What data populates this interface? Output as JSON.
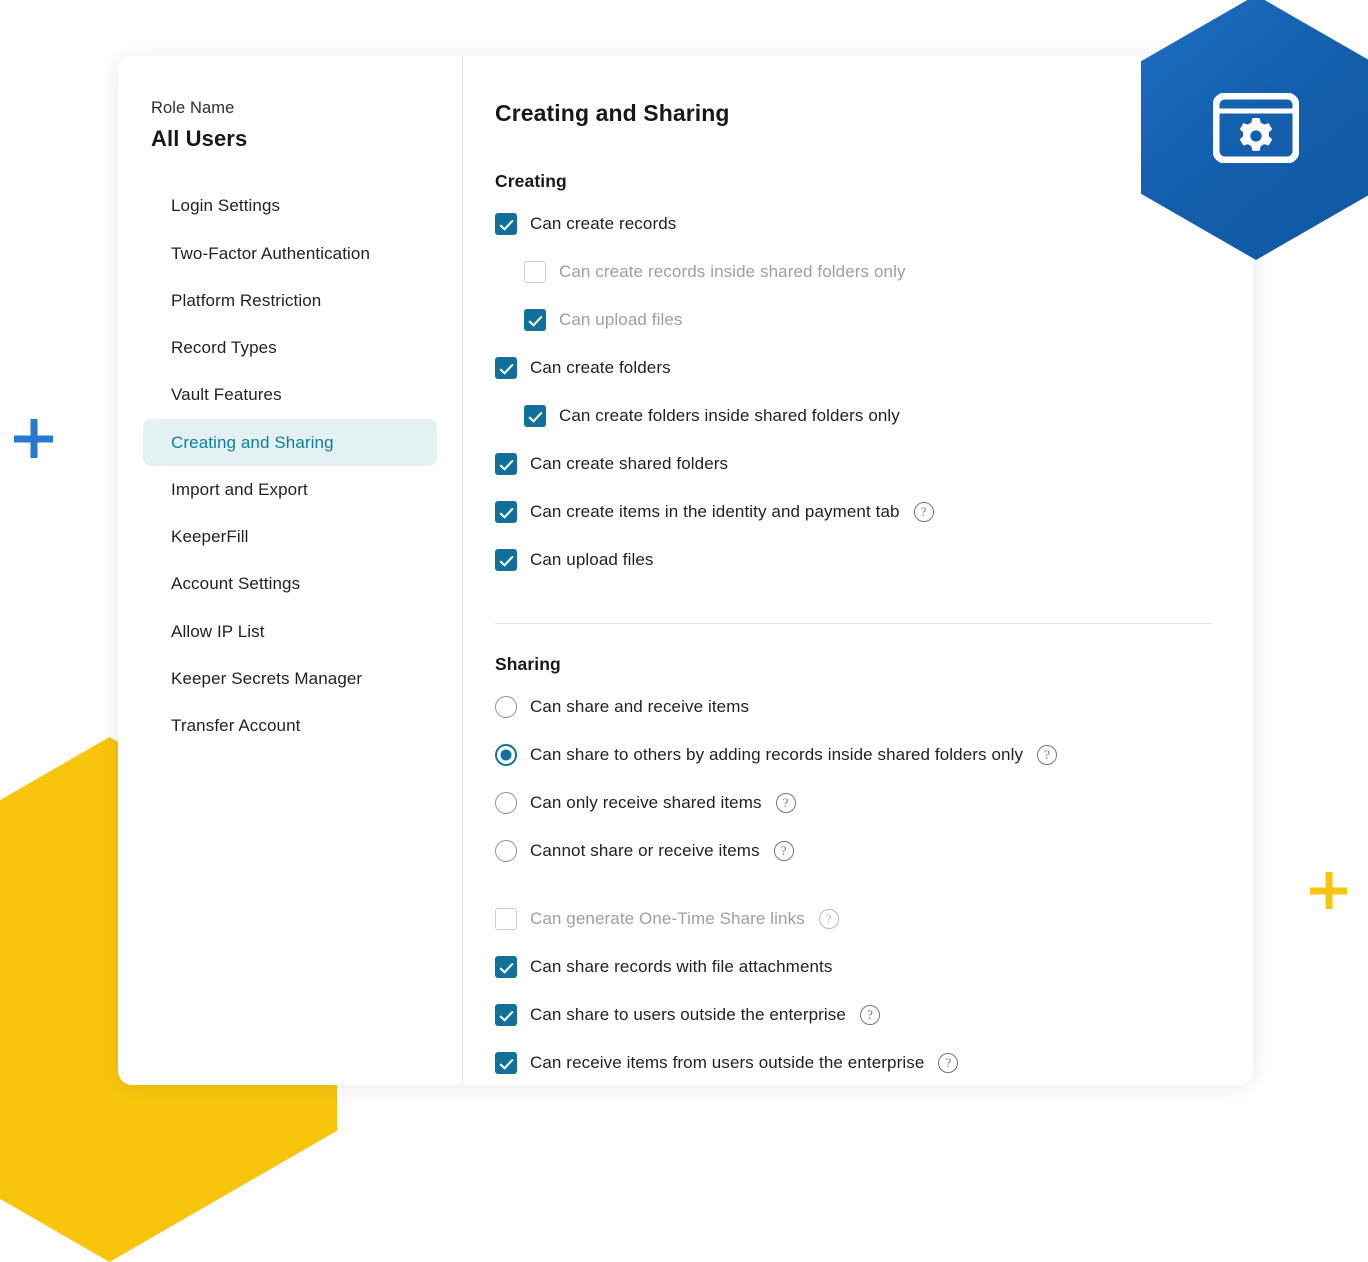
{
  "decor": {
    "hexagon_blue_icon": "browser-window-gear-icon",
    "hexagon_blue_color": "#1560ae",
    "hexagon_yellow_color": "#f8c50c",
    "plus_blue_color": "#2878d0",
    "plus_yellow_color": "#f8c50c"
  },
  "sidebar": {
    "role_label": "Role Name",
    "role_value": "All Users",
    "items": [
      {
        "label": "Login Settings",
        "active": false
      },
      {
        "label": "Two-Factor Authentication",
        "active": false
      },
      {
        "label": "Platform Restriction",
        "active": false
      },
      {
        "label": "Record Types",
        "active": false
      },
      {
        "label": "Vault Features",
        "active": false
      },
      {
        "label": "Creating and Sharing",
        "active": true
      },
      {
        "label": "Import and Export",
        "active": false
      },
      {
        "label": "KeeperFill",
        "active": false
      },
      {
        "label": "Account Settings",
        "active": false
      },
      {
        "label": "Allow IP List",
        "active": false
      },
      {
        "label": "Keeper Secrets Manager",
        "active": false
      },
      {
        "label": "Transfer Account",
        "active": false
      }
    ],
    "active_bg": "#e4f1f3",
    "active_color": "#0d7fa2"
  },
  "main": {
    "title": "Creating and Sharing",
    "accent_color": "#11719b",
    "creating": {
      "heading": "Creating",
      "options": [
        {
          "label": "Can create records",
          "control": "checkbox",
          "checked": true,
          "indent": false,
          "dim": false,
          "help": false
        },
        {
          "label": "Can create records inside shared folders only",
          "control": "checkbox",
          "checked": false,
          "indent": true,
          "dim": true,
          "help": false
        },
        {
          "label": "Can upload files",
          "control": "checkbox",
          "checked": true,
          "indent": true,
          "dim": true,
          "help": false
        },
        {
          "label": "Can create folders",
          "control": "checkbox",
          "checked": true,
          "indent": false,
          "dim": false,
          "help": false
        },
        {
          "label": "Can create folders inside shared folders only",
          "control": "checkbox",
          "checked": true,
          "indent": true,
          "dim": false,
          "help": false
        },
        {
          "label": "Can create shared folders",
          "control": "checkbox",
          "checked": true,
          "indent": false,
          "dim": false,
          "help": false
        },
        {
          "label": "Can create items in the identity and payment tab",
          "control": "checkbox",
          "checked": true,
          "indent": false,
          "dim": false,
          "help": true
        },
        {
          "label": "Can upload files",
          "control": "checkbox",
          "checked": true,
          "indent": false,
          "dim": false,
          "help": false
        }
      ]
    },
    "sharing": {
      "heading": "Sharing",
      "radio_options": [
        {
          "label": "Can share and receive items",
          "control": "radio",
          "checked": false,
          "indent": false,
          "dim": false,
          "help": false
        },
        {
          "label": "Can share to others by adding records inside shared folders only",
          "control": "radio",
          "checked": true,
          "indent": false,
          "dim": false,
          "help": true
        },
        {
          "label": "Can only receive shared items",
          "control": "radio",
          "checked": false,
          "indent": false,
          "dim": false,
          "help": true
        },
        {
          "label": "Cannot share or receive items",
          "control": "radio",
          "checked": false,
          "indent": false,
          "dim": false,
          "help": true
        }
      ],
      "checkbox_options": [
        {
          "label": "Can generate One-Time Share links",
          "control": "checkbox",
          "checked": false,
          "indent": false,
          "dim": true,
          "help": true
        },
        {
          "label": "Can share records with file attachments",
          "control": "checkbox",
          "checked": true,
          "indent": false,
          "dim": false,
          "help": false
        },
        {
          "label": "Can share to users outside the enterprise",
          "control": "checkbox",
          "checked": true,
          "indent": false,
          "dim": false,
          "help": true
        },
        {
          "label": "Can receive items from users outside the enterprise",
          "control": "checkbox",
          "checked": true,
          "indent": false,
          "dim": false,
          "help": true
        }
      ]
    },
    "help_glyph": "?"
  }
}
